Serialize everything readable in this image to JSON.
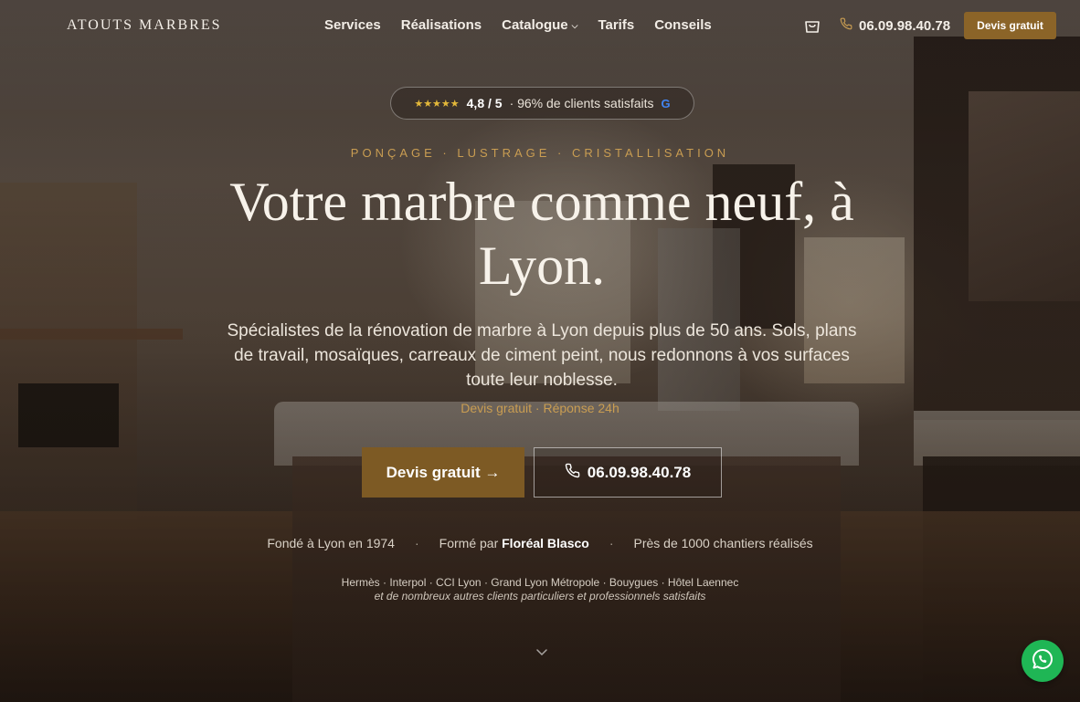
{
  "header": {
    "logo": "ATOUTS MARBRES",
    "nav": [
      {
        "label": "Services"
      },
      {
        "label": "Réalisations"
      },
      {
        "label": "Catalogue",
        "dropdown": true
      },
      {
        "label": "Tarifs"
      },
      {
        "label": "Conseils"
      }
    ],
    "cart_icon": "shopping-bag-icon",
    "phone": "06.09.98.40.78",
    "cta_label": "Devis gratuit"
  },
  "hero": {
    "rating": {
      "stars": "★★★★★",
      "score": "4,8 / 5",
      "text": "· 96% de clients satisfaits",
      "badge": "G"
    },
    "eyebrow": "PONÇAGE · LUSTRAGE · CRISTALLISATION",
    "headline": "Votre marbre comme neuf, à Lyon.",
    "subtitle": "Spécialistes de la rénovation de marbre à Lyon depuis plus de 50 ans. Sols, plans de travail, mosaïques, carreaux de ciment peint, nous redonnons à vos surfaces toute leur noblesse.",
    "subnote": "Devis gratuit · Réponse 24h",
    "primary_button": "Devis gratuit →",
    "secondary_button": "06.09.98.40.78",
    "facts": {
      "founded": "Fondé à Lyon en 1974",
      "trained_prefix": "Formé par",
      "trained_name": "Floréal Blasco",
      "sites": "Près de 1000 chantiers réalisés",
      "separator": "·"
    },
    "clients": "Hermès · Interpol · CCI Lyon · Grand Lyon Métropole · Bouygues · Hôtel Laennec",
    "clients_note": "et de nombreux autres clients particuliers et professionnels satisfaits"
  },
  "colors": {
    "accent": "#8b6428",
    "eyebrow": "#c99d52",
    "whatsapp": "#1fb655",
    "stars": "#e3b83a"
  },
  "floating": {
    "whatsapp_icon": "whatsapp-icon"
  }
}
